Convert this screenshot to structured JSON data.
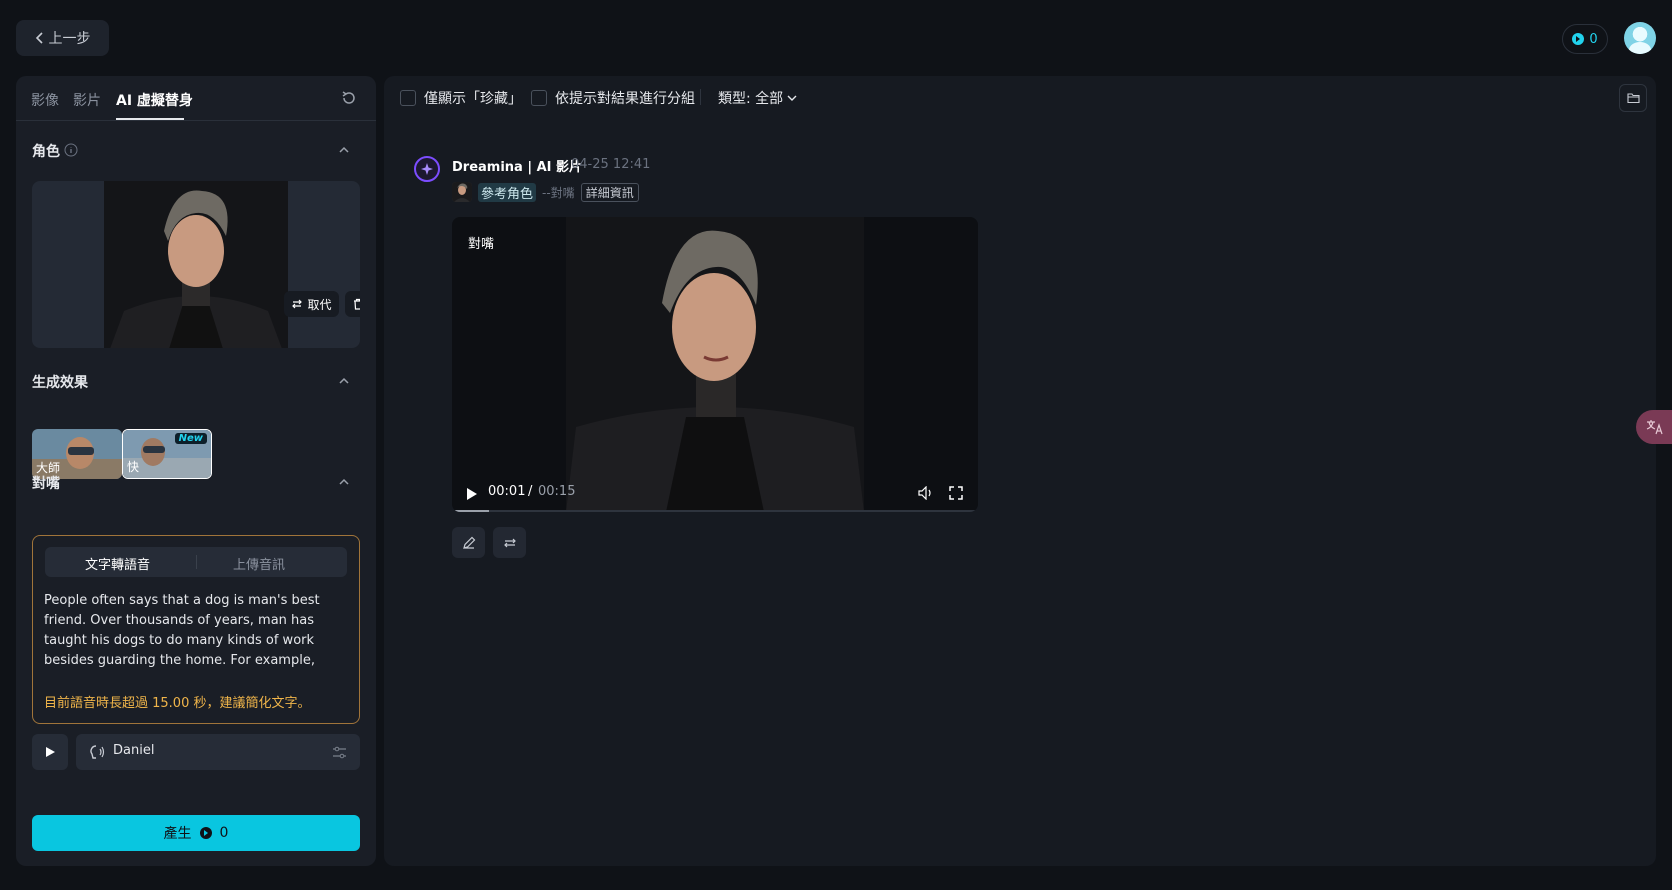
{
  "topbar": {
    "back_label": "上一步",
    "credits": "0"
  },
  "left_panel": {
    "tabs": [
      {
        "label": "影像",
        "active": false
      },
      {
        "label": "影片",
        "active": false
      },
      {
        "label": "AI 虛擬替身",
        "active": true
      }
    ],
    "role_section": {
      "title": "角色",
      "replace_label": "取代"
    },
    "effect_section": {
      "title": "生成效果",
      "effects": [
        {
          "label": "大師",
          "badge": ""
        },
        {
          "label": "快",
          "badge": "New"
        }
      ]
    },
    "lipsync_section": {
      "title": "對嘴",
      "modes": [
        "文字轉語音",
        "上傳音訊"
      ],
      "script": "People often says that a dog is man's best friend. Over thousands of years, man has taught his dogs to do many kinds of work besides guarding the home. For example, sheepdogs are famous for their ability to control a flock of hundreds of sh",
      "warning": "目前語音時長超過 15.00 秒，建議簡化文字。",
      "voice_name": "Daniel"
    },
    "generate": {
      "label": "產生",
      "cost": "0"
    }
  },
  "right_panel": {
    "filters": {
      "favorites_only": "僅顯示「珍藏」",
      "group_by_prompt": "依提示對結果進行分組",
      "type_filter": "類型: 全部"
    },
    "message": {
      "source": "Dreamina | AI 影片",
      "date": "04-25",
      "time": "12:41",
      "ref_role": "參考角色",
      "ref_mode": "--對嘴",
      "detail_tag": "詳細資訊",
      "video_tag": "對嘴",
      "current_time": "00:01",
      "time_sep": "/",
      "duration": "00:15",
      "progress": 0.07
    }
  },
  "colors": {
    "accent": "#09c6e0",
    "warning": "#f0b54a",
    "brand_purple": "#7c4dff"
  }
}
